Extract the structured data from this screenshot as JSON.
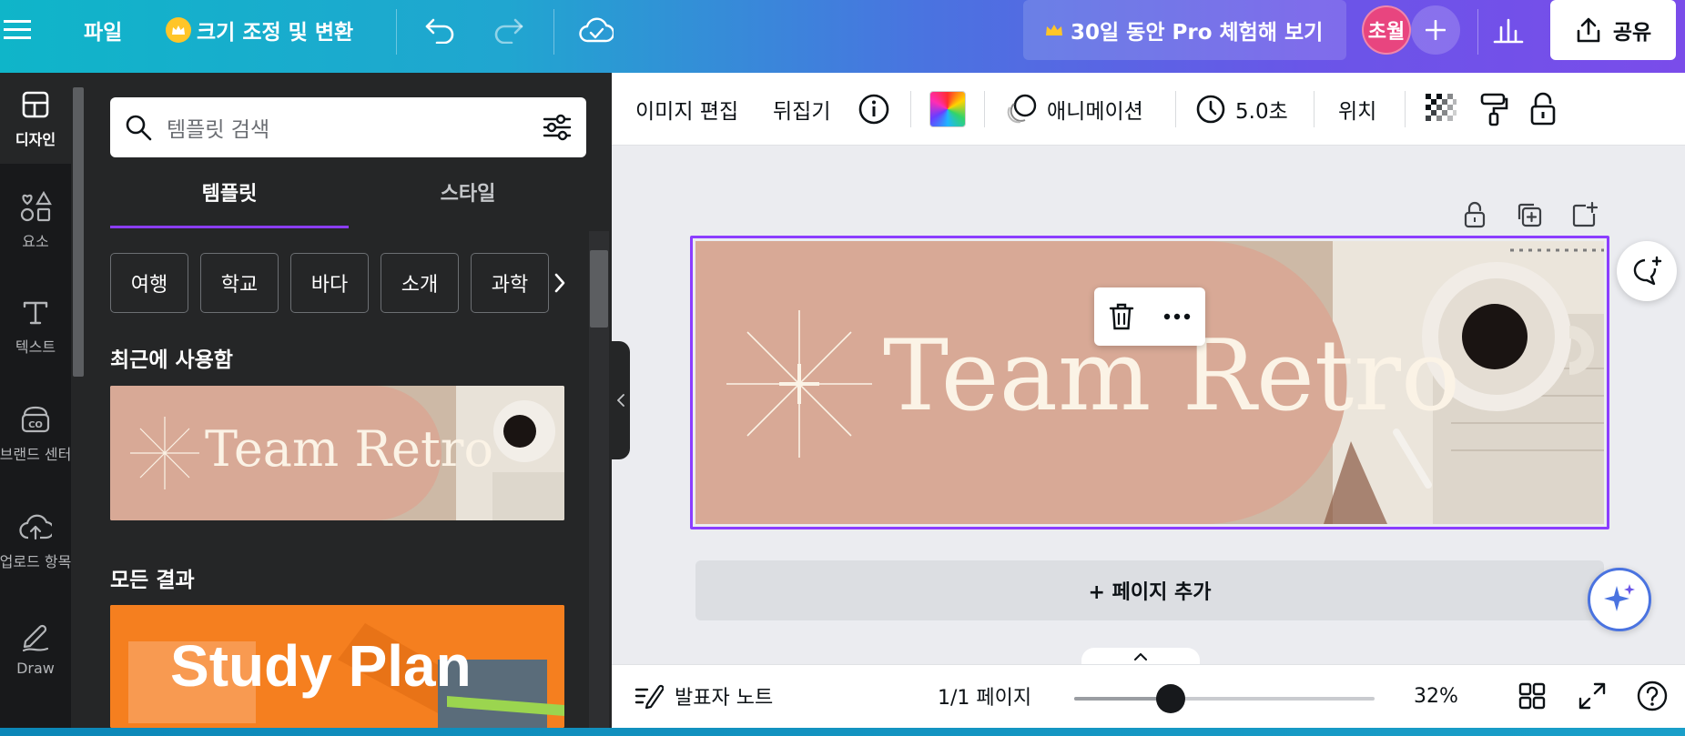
{
  "topbar": {
    "menu_icon": "hamburger-icon",
    "file_label": "파일",
    "resize_label": "크기 조정 및 변환",
    "pro_trial_label": "30일 동안 Pro 체험해 보기",
    "avatar_initials": "초월",
    "share_label": "공유"
  },
  "rail": {
    "items": [
      {
        "label": "디자인",
        "icon": "design-icon"
      },
      {
        "label": "요소",
        "icon": "elements-icon"
      },
      {
        "label": "텍스트",
        "icon": "text-icon"
      },
      {
        "label": "브랜드 센터",
        "icon": "brand-icon"
      },
      {
        "label": "업로드 항목",
        "icon": "upload-icon"
      },
      {
        "label": "Draw",
        "icon": "draw-icon"
      }
    ]
  },
  "panel": {
    "search_placeholder": "템플릿 검색",
    "tabs": [
      {
        "label": "템플릿",
        "active": true
      },
      {
        "label": "스타일",
        "active": false
      }
    ],
    "chips": [
      "여행",
      "학교",
      "바다",
      "소개",
      "과학"
    ],
    "recent_title": "최근에 사용함",
    "all_results_title": "모든 결과",
    "recent_template_text": "Team Retro",
    "result_template_text": "Study Plan"
  },
  "context_toolbar": {
    "edit_image": "이미지 편집",
    "flip": "뒤집기",
    "animation": "애니메이션",
    "duration": "5.0초",
    "position": "위치"
  },
  "canvas": {
    "design_text": "Team Retro",
    "add_page": "+ 페이지 추가"
  },
  "bottombar": {
    "notes_label": "발표자 노트",
    "page_label": "1/1 페이지",
    "zoom_label": "32%",
    "zoom_fraction": 0.32
  },
  "colors": {
    "accent": "#8b3dff",
    "design_bg": "#d8a996",
    "design_text": "#fbf3e6",
    "study_plan_bg": "#f57f1f"
  }
}
